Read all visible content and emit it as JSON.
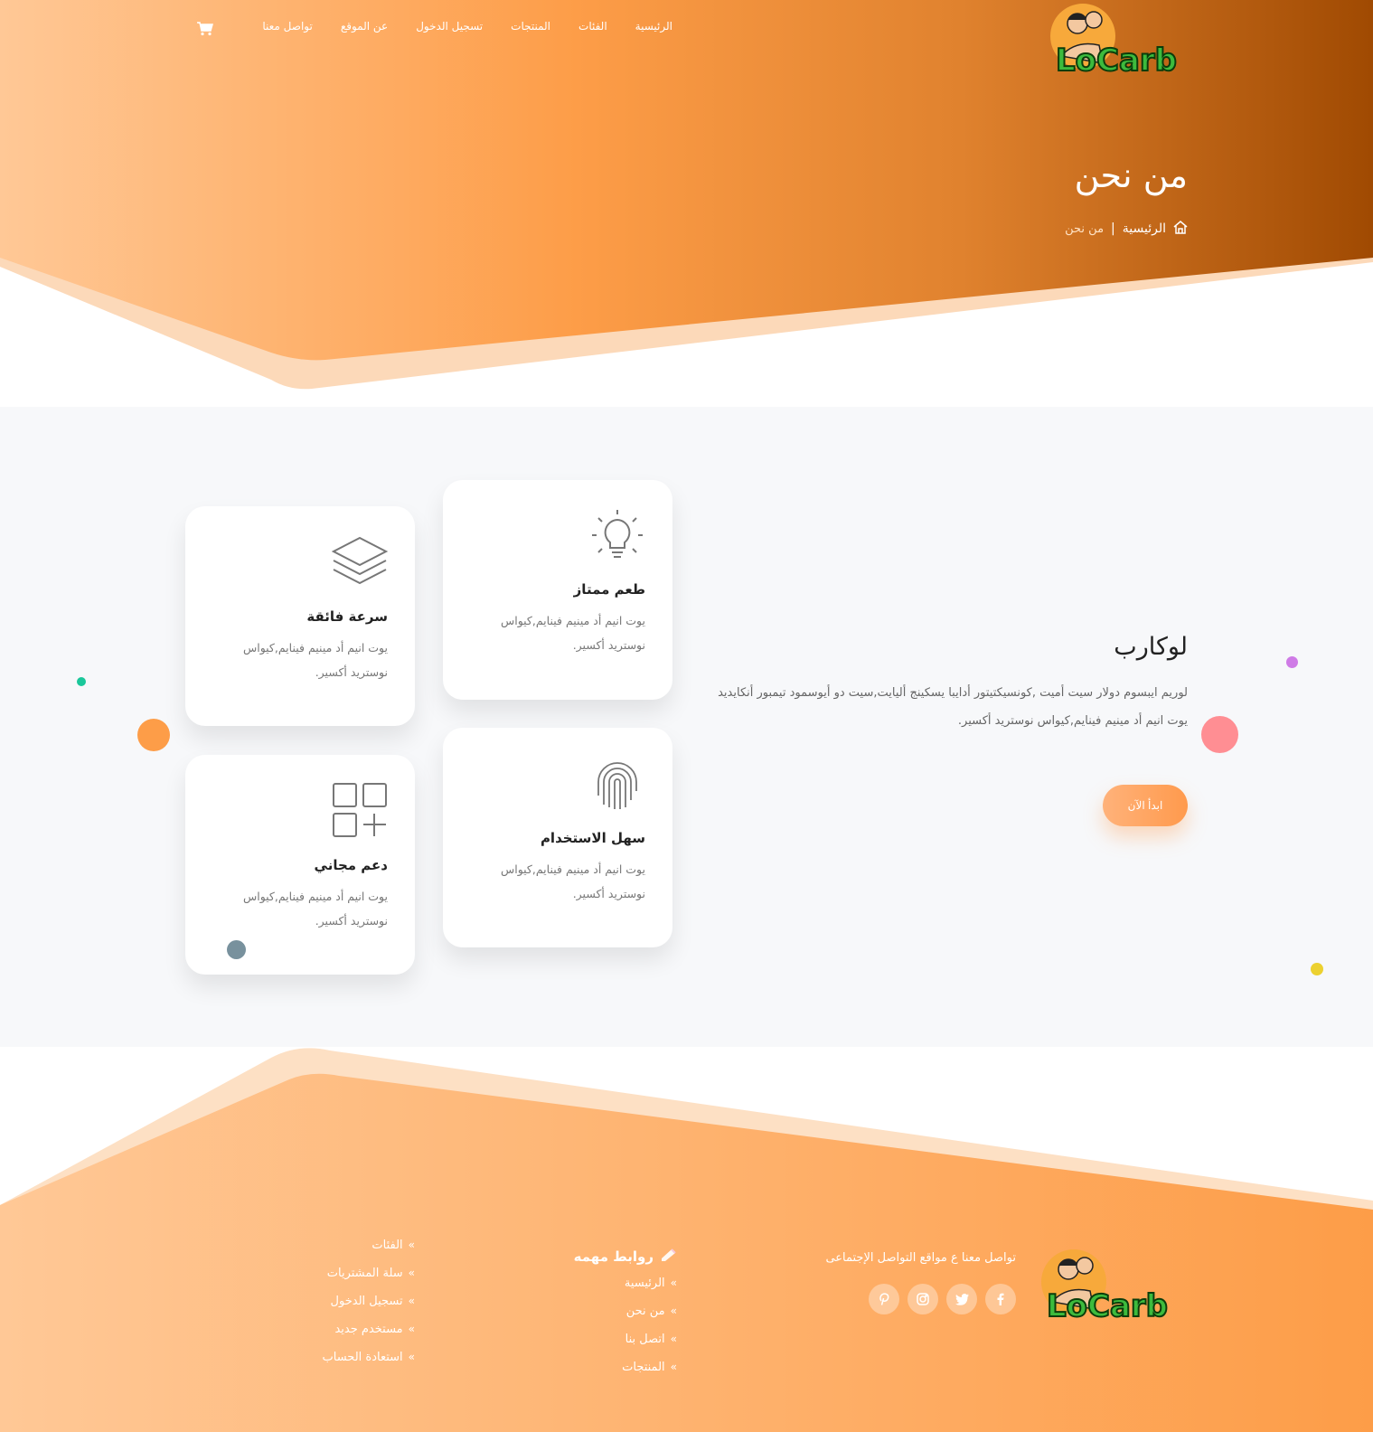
{
  "brand": {
    "logo_text": "LoCarb",
    "colors": {
      "orange_light": "#ffc896",
      "orange": "#ff9e48",
      "orange_dark": "#a34d00",
      "main_bg": "#f7f8fa"
    }
  },
  "nav": {
    "items": [
      "الرئيسية",
      "الفئات",
      "المنتجات",
      "تسجيل الدخول",
      "عن الموقع",
      "تواصل معنا"
    ],
    "cart_icon": "shopping-cart-icon"
  },
  "hero": {
    "title": "من نحن",
    "breadcrumb": {
      "home": "الرئيسية",
      "separator": "|",
      "current": "من نحن"
    }
  },
  "about": {
    "title": "لوكارب",
    "text_1": "لوريم ايبسوم دولار سيت أميت ,كونسيكتيتور أدايبا يسكينج أليايت,سيت دو أيوسمود تيمبور أنكايديد",
    "text_2": "يوت انيم أد مينيم فينايم,كيواس نوستريد أكسير.",
    "button": "ابدأ الآن"
  },
  "features": [
    {
      "icon": "lightbulb-icon",
      "title": "طعم ممتاز",
      "text": "يوت انيم أد مينيم فينايم,كيواس نوستريد أكسير."
    },
    {
      "icon": "layers-icon",
      "title": "سرعة فائقة",
      "text": "يوت انيم أد مينيم فينايم,كيواس نوستريد أكسير."
    },
    {
      "icon": "fingerprint-icon",
      "title": "سهل الاستخدام",
      "text": "يوت انيم أد مينيم فينايم,كيواس نوستريد أكسير."
    },
    {
      "icon": "grid-plus-icon",
      "title": "دعم مجاني",
      "text": "يوت انيم أد مينيم فينايم,كيواس نوستريد أكسير."
    }
  ],
  "footer": {
    "social_text": "تواصل معنا ع مواقع التواصل الإجتماعى",
    "socials": [
      "facebook-icon",
      "twitter-icon",
      "instagram-icon",
      "pinterest-icon"
    ],
    "links_title": "روابط مهمه",
    "links_col1": [
      "الرئيسية",
      "من نحن",
      "اتصل بنا",
      "المنتجات"
    ],
    "links_col2": [
      "الفئات",
      "سلة المشتريات",
      "تسجيل الدخول",
      "مستخدم جديد",
      "استعادة الحساب"
    ],
    "chevron": "»"
  }
}
